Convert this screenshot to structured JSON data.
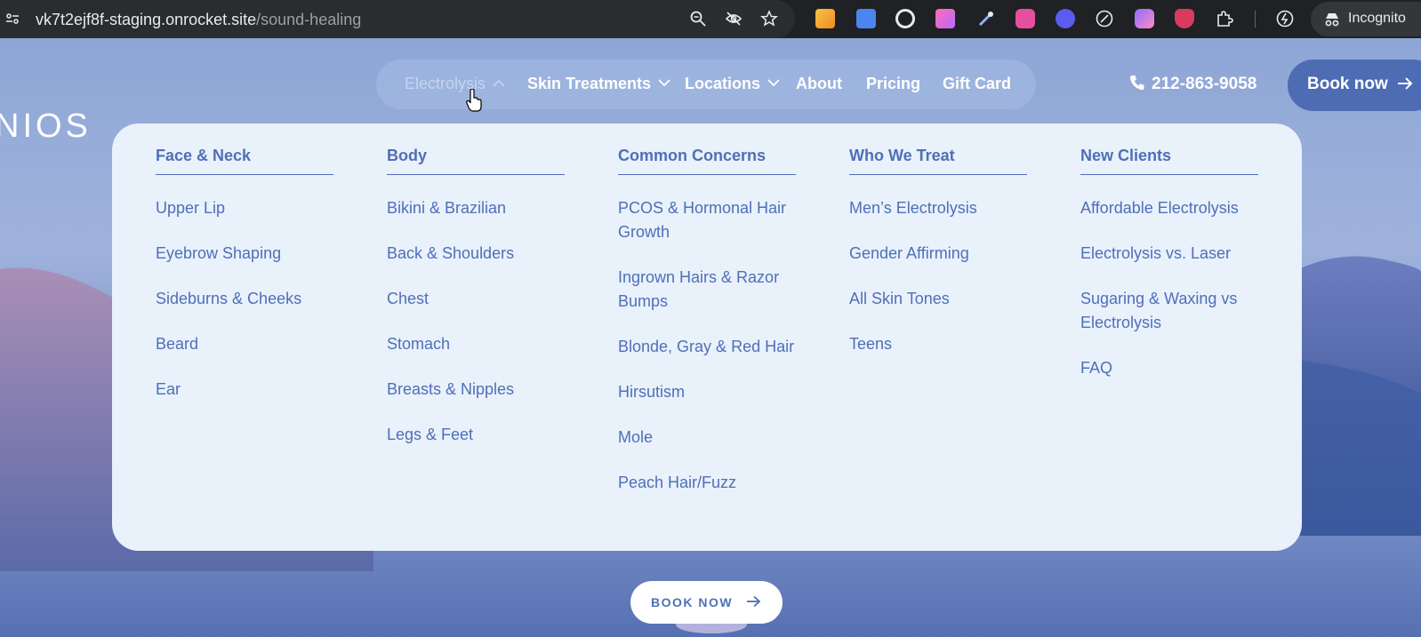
{
  "browser": {
    "url_host": "vk7t2ejf8f-staging.onrocket.site",
    "url_path": "/sound-healing",
    "mode_label": "Incognito",
    "icons": [
      "site-info-icon",
      "zoom-icon",
      "eye-slash-icon",
      "star-icon",
      "extension-icons",
      "puzzle-icon",
      "incognito-icon"
    ]
  },
  "site": {
    "logo_text": "NIOS"
  },
  "nav": {
    "items": [
      {
        "label": "Electrolysis"
      },
      {
        "label": "Skin Treatments"
      },
      {
        "label": "Locations"
      },
      {
        "label": "About"
      },
      {
        "label": "Pricing"
      },
      {
        "label": "Gift Card"
      }
    ],
    "phone": "212-863-9058",
    "book_label": "Book now"
  },
  "dropdown": {
    "columns": [
      {
        "title": "Face & Neck",
        "links": [
          "Upper Lip",
          "Eyebrow Shaping",
          "Sideburns & Cheeks",
          "Beard",
          "Ear"
        ]
      },
      {
        "title": "Body",
        "links": [
          "Bikini & Brazilian",
          "Back & Shoulders",
          "Chest",
          "Stomach",
          "Breasts & Nipples",
          "Legs & Feet"
        ]
      },
      {
        "title": "Common Concerns",
        "links": [
          "PCOS & Hormonal Hair Growth",
          "Ingrown Hairs & Razor Bumps",
          "Blonde, Gray & Red Hair",
          "Hirsutism",
          "Mole",
          "Peach Hair/Fuzz"
        ]
      },
      {
        "title": "Who We Treat",
        "links": [
          "Men’s Electrolysis",
          "Gender Affirming",
          "All Skin Tones",
          "Teens"
        ]
      },
      {
        "title": "New Clients",
        "links": [
          "Affordable Electrolysis",
          "Electrolysis vs. Laser",
          "Sugaring & Waxing vs Electrolysis",
          "FAQ"
        ]
      }
    ]
  },
  "cta": {
    "label": "BOOK NOW"
  },
  "colors": {
    "accent": "#4f6fb7",
    "panel": "#e9f1fb",
    "book_button": "#4d6cb4"
  }
}
